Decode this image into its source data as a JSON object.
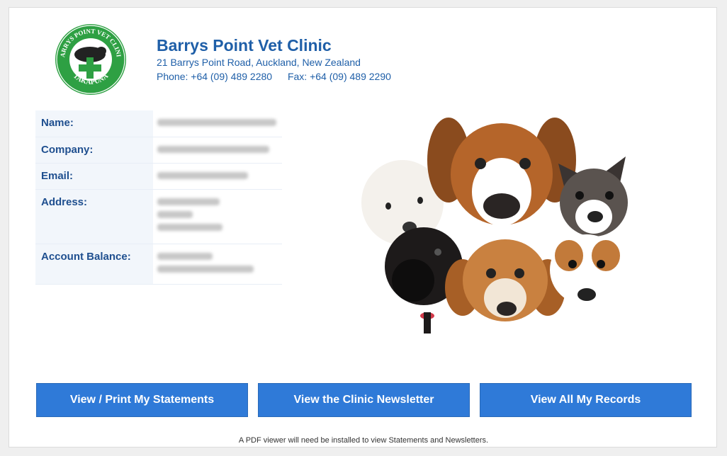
{
  "clinic": {
    "name": "Barrys Point Vet Clinic",
    "address": "21 Barrys Point Road, Auckland, New Zealand",
    "phone": "Phone: +64 (09) 489 2280",
    "fax": "Fax: +64 (09) 489 2290",
    "logo_top_text": "BARRYS POINT VET CLINIC",
    "logo_bottom_text": "TAKAPUNA"
  },
  "colors": {
    "brand_blue": "#1f5fa8",
    "button_blue": "#2f7ad8",
    "logo_green": "#2ea043"
  },
  "customer": {
    "labels": {
      "name": "Name:",
      "company": "Company:",
      "email": "Email:",
      "address": "Address:",
      "balance": "Account Balance:"
    }
  },
  "buttons": {
    "statements": "View / Print My Statements",
    "newsletter": "View the Clinic Newsletter",
    "records": "View All My Records"
  },
  "footer_note": "A PDF viewer will need be installed to view Statements and Newsletters."
}
